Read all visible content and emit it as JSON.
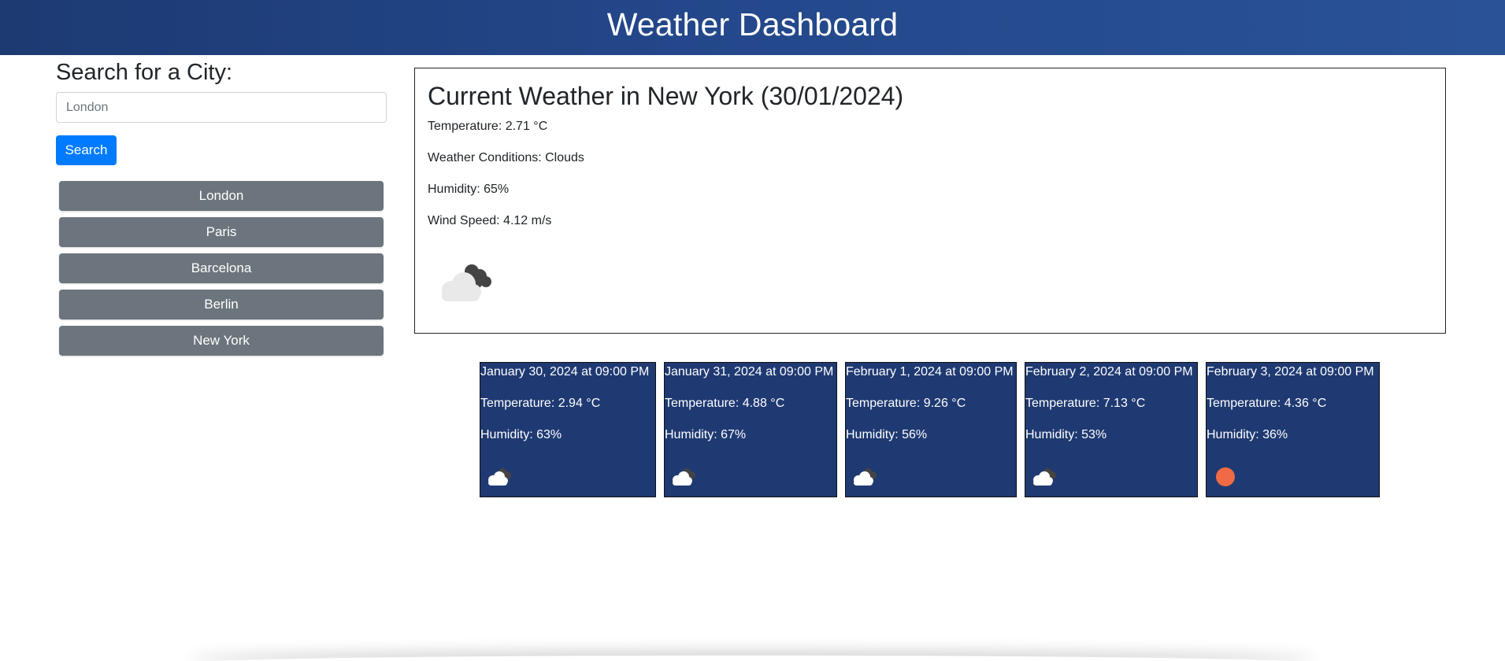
{
  "header": {
    "title": "Weather Dashboard"
  },
  "search": {
    "heading": "Search for a City:",
    "placeholder": "London",
    "button_label": "Search"
  },
  "history": [
    "London",
    "Paris",
    "Barcelona",
    "Berlin",
    "New York"
  ],
  "current": {
    "heading": "Current Weather in New York (30/01/2024)",
    "temperature": "Temperature: 2.71 °C",
    "conditions": "Weather Conditions: Clouds",
    "humidity": "Humidity: 65%",
    "wind": "Wind Speed: 4.12 m/s",
    "icon": "broken-clouds-icon"
  },
  "forecast": [
    {
      "date": "January 30, 2024 at 09:00 PM",
      "temperature": "Temperature: 2.94 °C",
      "humidity": "Humidity: 63%",
      "icon": "broken-clouds-icon"
    },
    {
      "date": "January 31, 2024 at 09:00 PM",
      "temperature": "Temperature: 4.88 °C",
      "humidity": "Humidity: 67%",
      "icon": "broken-clouds-icon"
    },
    {
      "date": "February 1, 2024 at 09:00 PM",
      "temperature": "Temperature: 9.26 °C",
      "humidity": "Humidity: 56%",
      "icon": "broken-clouds-icon"
    },
    {
      "date": "February 2, 2024 at 09:00 PM",
      "temperature": "Temperature: 7.13 °C",
      "humidity": "Humidity: 53%",
      "icon": "broken-clouds-icon"
    },
    {
      "date": "February 3, 2024 at 09:00 PM",
      "temperature": "Temperature: 4.36 °C",
      "humidity": "Humidity: 36%",
      "icon": "clear-sky-sun-icon"
    }
  ],
  "colors": {
    "header_start": "#1d3a72",
    "header_end": "#2a5296",
    "primary_button": "#007bff",
    "history_button": "#6c757d",
    "forecast_card": "#1f3a72",
    "sun": "#ef6a45"
  }
}
